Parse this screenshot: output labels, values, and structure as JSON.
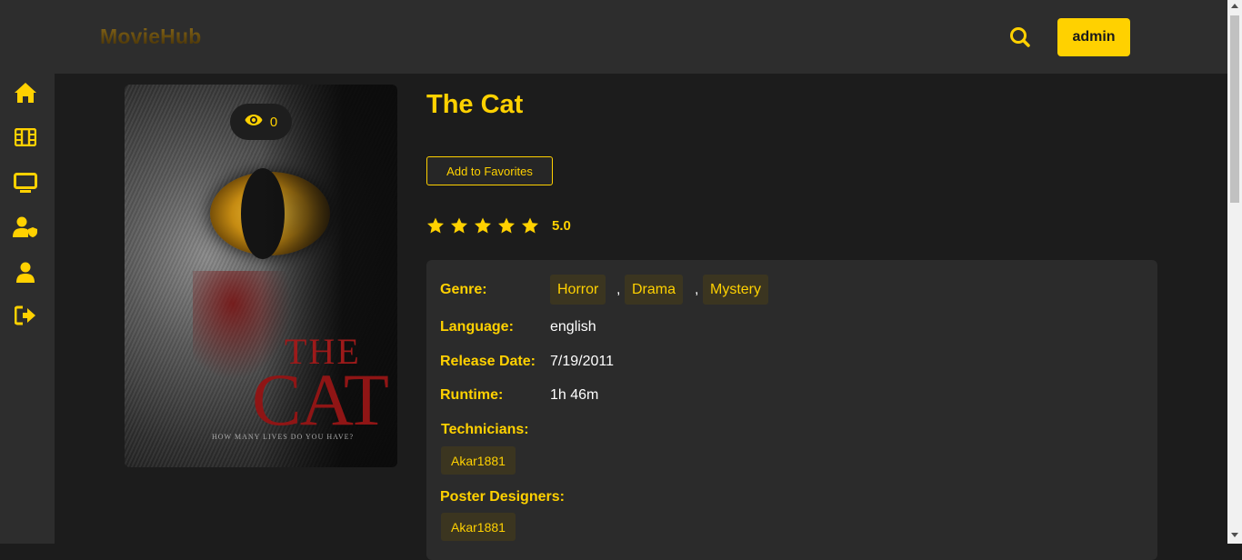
{
  "header": {
    "logo": "MovieHub",
    "user_button": "admin"
  },
  "sidebar": {
    "items": [
      {
        "icon": "home-icon"
      },
      {
        "icon": "film-icon"
      },
      {
        "icon": "tv-icon"
      },
      {
        "icon": "user-shield-icon"
      },
      {
        "icon": "user-icon"
      },
      {
        "icon": "logout-icon"
      }
    ]
  },
  "poster": {
    "views": "0",
    "title_line1": "THE",
    "title_line2": "CAT",
    "tagline": "HOW MANY LIVES DO YOU HAVE?"
  },
  "movie": {
    "title": "The Cat",
    "favorite_button": "Add to Favorites",
    "rating": "5.0",
    "stars": 5
  },
  "details": {
    "genre_label": "Genre:",
    "genres": [
      "Horror",
      "Drama",
      "Mystery"
    ],
    "language_label": "Language:",
    "language": "english",
    "release_label": "Release Date:",
    "release_date": "7/19/2011",
    "runtime_label": "Runtime:",
    "runtime": "1h 46m",
    "technicians_label": "Technicians:",
    "technicians": [
      "Akar1881"
    ],
    "poster_designers_label": "Poster Designers:",
    "poster_designers": [
      "Akar1881"
    ]
  },
  "colors": {
    "accent": "#ffd100",
    "bg": "#1c1c1c",
    "panel": "#2b2b2b",
    "bar": "#2d2d2d"
  }
}
